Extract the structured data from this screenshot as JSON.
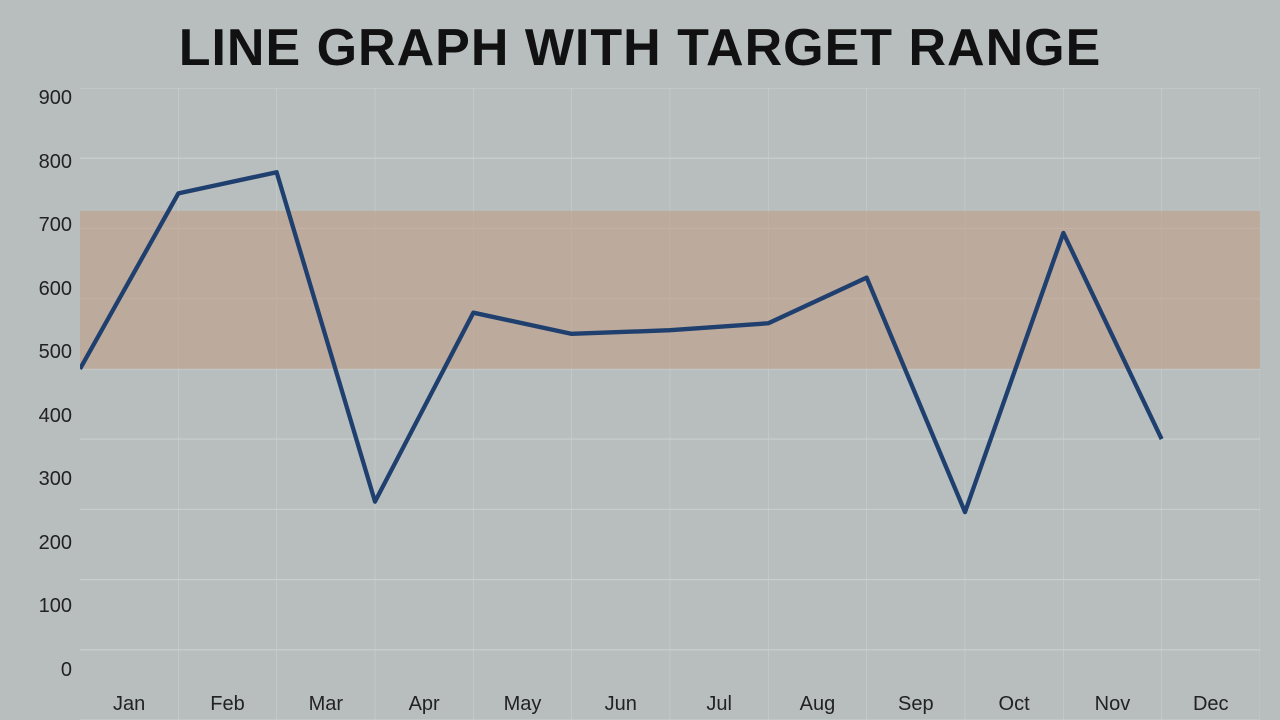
{
  "title": "LINE GRAPH WITH TARGET RANGE",
  "yAxis": {
    "labels": [
      "900",
      "800",
      "700",
      "600",
      "500",
      "400",
      "300",
      "200",
      "100",
      "0"
    ]
  },
  "xAxis": {
    "labels": [
      "Jan",
      "Feb",
      "Mar",
      "Apr",
      "May",
      "Jun",
      "Jul",
      "Aug",
      "Sep",
      "Oct",
      "Nov",
      "Dec"
    ]
  },
  "data": {
    "values": [
      500,
      750,
      780,
      310,
      580,
      550,
      555,
      565,
      630,
      295,
      695,
      400
    ],
    "targetMin": 500,
    "targetMax": 725
  },
  "colors": {
    "line": "#1f3f6e",
    "target": "rgba(190,160,140,0.65)",
    "gridBg": "#b8bebe",
    "gridLine": "#c8d0d0"
  }
}
